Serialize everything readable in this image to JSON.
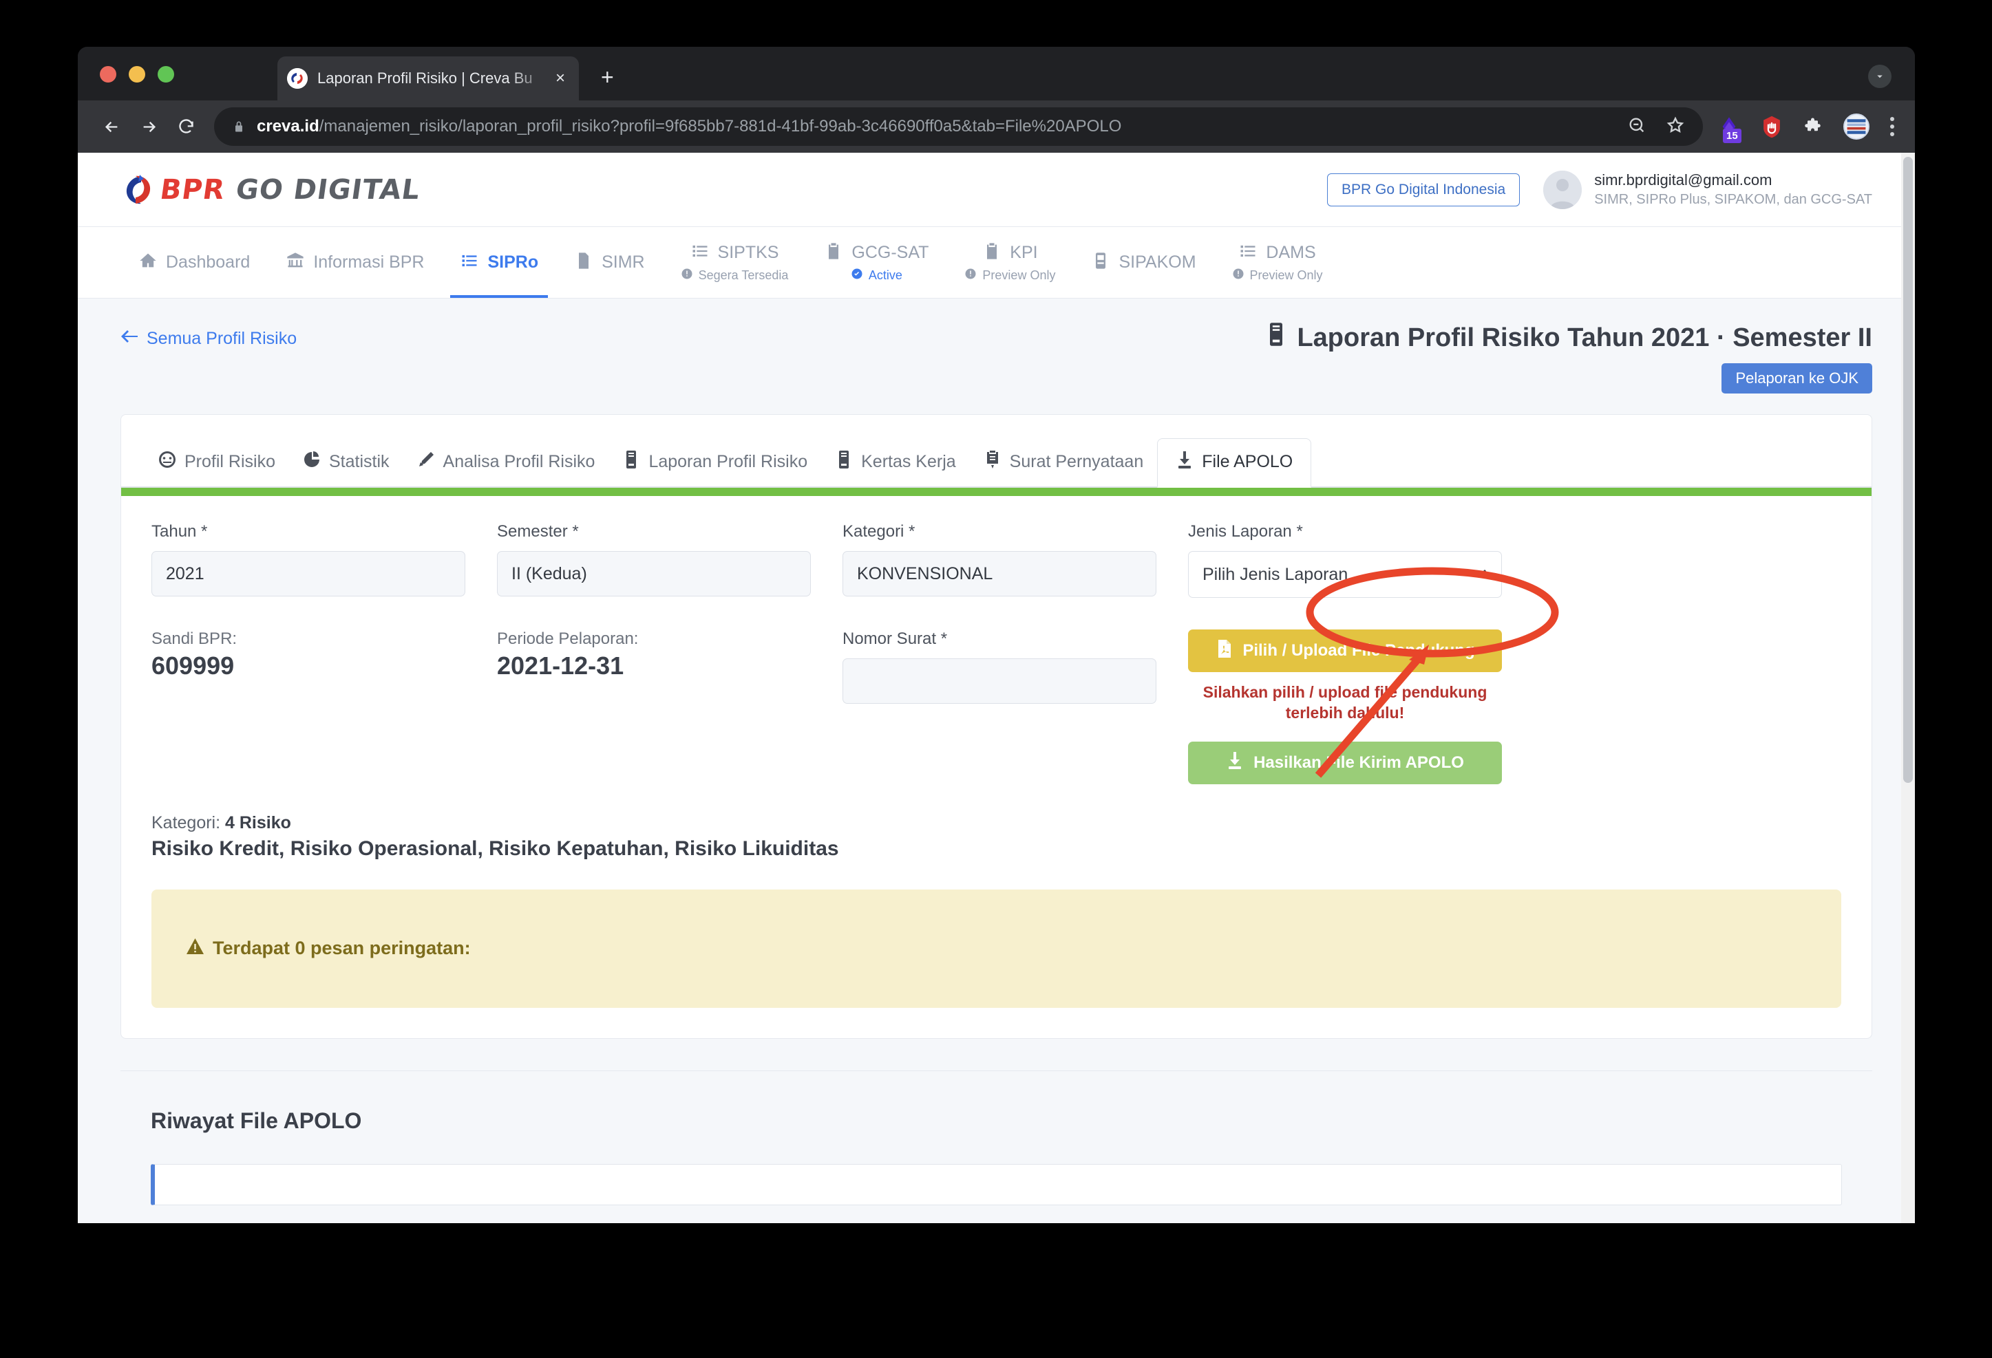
{
  "browser": {
    "tab_title": "Laporan Profil Risiko | Creva Bu",
    "tab_close_label": "×",
    "new_tab_label": "+",
    "url_host": "creva.id",
    "url_path": "/manajemen_risiko/laporan_profil_risiko?profil=9f685bb7-881d-41bf-99ab-3c46690ff0a5&tab=File%20APOLO",
    "extension_badge": "15"
  },
  "header": {
    "logo_bpr": "BPR",
    "logo_go_digital": "GO DIGITAL",
    "org_pill": "BPR Go Digital Indonesia",
    "user_email": "simr.bprdigital@gmail.com",
    "user_roles": "SIMR, SIPRo Plus, SIPAKOM, dan GCG-SAT"
  },
  "nav": {
    "items": [
      {
        "label": "Dashboard",
        "icon": "home-icon",
        "sub": "",
        "active": false
      },
      {
        "label": "Informasi BPR",
        "icon": "bank-icon",
        "sub": "",
        "active": false
      },
      {
        "label": "SIPRo",
        "icon": "list-icon",
        "sub": "",
        "active": true
      },
      {
        "label": "SIMR",
        "icon": "document-icon",
        "sub": "",
        "active": false
      },
      {
        "label": "SIPTKS",
        "icon": "list-icon",
        "sub": "Segera Tersedia",
        "active": false
      },
      {
        "label": "GCG-SAT",
        "icon": "clipboard-check-icon",
        "sub": "Active",
        "active": false
      },
      {
        "label": "KPI",
        "icon": "clipboard-icon",
        "sub": "Preview Only",
        "active": false
      },
      {
        "label": "SIPAKOM",
        "icon": "server-icon",
        "sub": "",
        "active": false
      },
      {
        "label": "DAMS",
        "icon": "list-icon",
        "sub": "Preview Only",
        "active": false
      }
    ]
  },
  "page": {
    "back_link": "Semua Profil Risiko",
    "title": "Laporan Profil Risiko Tahun 2021 · Semester II",
    "ojk_badge": "Pelaporan ke OJK"
  },
  "tabs": [
    {
      "label": "Profil Risiko",
      "icon": "gauge-icon",
      "active": false
    },
    {
      "label": "Statistik",
      "icon": "pie-chart-icon",
      "active": false
    },
    {
      "label": "Analisa Profil Risiko",
      "icon": "pencil-icon",
      "active": false
    },
    {
      "label": "Laporan Profil Risiko",
      "icon": "book-icon",
      "active": false
    },
    {
      "label": "Kertas Kerja",
      "icon": "book-icon",
      "active": false
    },
    {
      "label": "Surat Pernyataan",
      "icon": "certificate-icon",
      "active": false
    },
    {
      "label": "File APOLO",
      "icon": "download-icon",
      "active": true
    }
  ],
  "form": {
    "tahun_label": "Tahun *",
    "tahun_value": "2021",
    "semester_label": "Semester *",
    "semester_value": "II (Kedua)",
    "kategori_label": "Kategori *",
    "kategori_value": "KONVENSIONAL",
    "jenis_laporan_label": "Jenis Laporan *",
    "jenis_laporan_value": "Pilih Jenis Laporan",
    "sandi_label": "Sandi BPR:",
    "sandi_value": "609999",
    "periode_label": "Periode Pelaporan:",
    "periode_value": "2021-12-31",
    "nomor_surat_label": "Nomor Surat *",
    "nomor_surat_value": "",
    "upload_button": "Pilih / Upload File Pendukung",
    "upload_warning": "Silahkan pilih / upload file pendukung terlebih dahulu!",
    "generate_button": "Hasilkan File Kirim APOLO"
  },
  "summary": {
    "kategori_prefix": "Kategori: ",
    "kategori_count": "4 Risiko",
    "risk_list": "Risiko Kredit, Risiko Operasional, Risiko Kepatuhan, Risiko Likuiditas"
  },
  "alert": {
    "message": "Terdapat 0 pesan peringatan:"
  },
  "history": {
    "title": "Riwayat File APOLO"
  },
  "colors": {
    "accent_blue": "#3d7bed",
    "green_bar": "#72bf44",
    "gold_button": "#e3c341",
    "green_button": "#9acd78",
    "warning_red": "#b5342f",
    "alert_bg": "#f7f0ce",
    "annotation_red": "#e8452a"
  }
}
